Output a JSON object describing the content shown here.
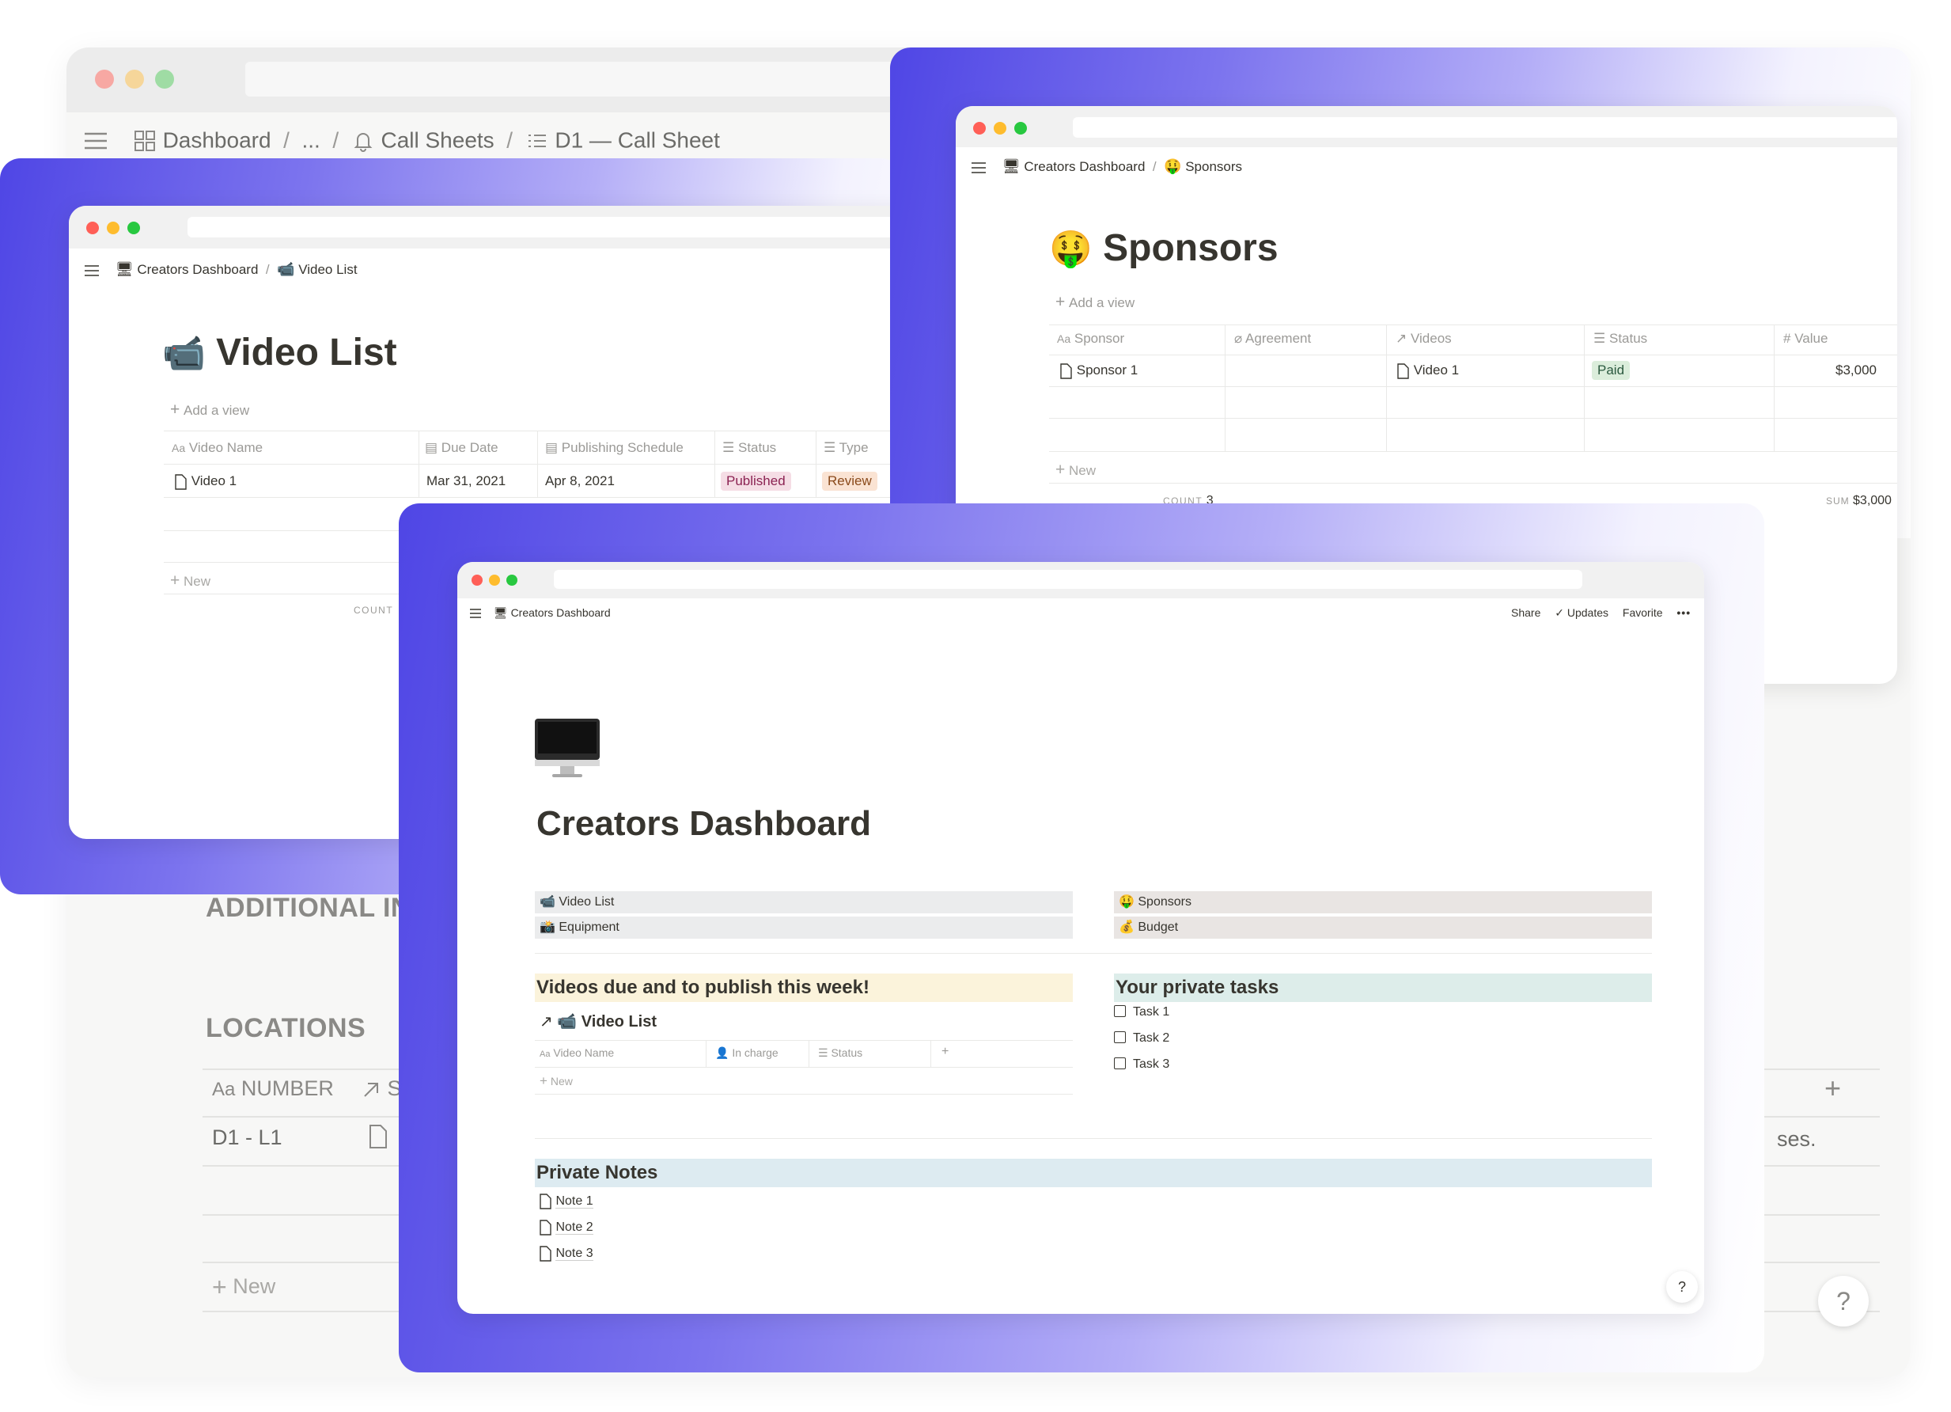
{
  "background_window": {
    "breadcrumb": [
      "Dashboard",
      "...",
      "Call Sheets",
      "D1 — Call Sheet"
    ],
    "section_additional": "ADDITIONAL INFO",
    "section_locations": "LOCATIONS",
    "table": {
      "headers": [
        "NUMBER",
        "S"
      ],
      "row_number": "D1 - L1",
      "row_tail_text": "ses.",
      "new_label": "New"
    },
    "help_label": "?"
  },
  "video_list_window": {
    "breadcrumb": [
      "Creators Dashboard",
      "Video List"
    ],
    "title": "Video List",
    "add_view": "Add a view",
    "columns": [
      "Video Name",
      "Due Date",
      "Publishing Schedule",
      "Status",
      "Type"
    ],
    "rows": [
      {
        "name": "Video 1",
        "due": "Mar 31, 2021",
        "publish": "Apr 8, 2021",
        "status": "Published",
        "type": "Review"
      }
    ],
    "new_label": "New",
    "count_label": "COUNT"
  },
  "sponsors_window": {
    "breadcrumb": [
      "Creators Dashboard",
      "Sponsors"
    ],
    "title": "Sponsors",
    "add_view": "Add a view",
    "columns": [
      "Sponsor",
      "Agreement",
      "Videos",
      "Status",
      "Value"
    ],
    "rows": [
      {
        "sponsor": "Sponsor 1",
        "agreement": "",
        "videos": "Video 1",
        "status": "Paid",
        "value": "$3,000"
      }
    ],
    "new_label": "New",
    "count_label": "COUNT",
    "count_value": "3",
    "sum_label": "SUM",
    "sum_value": "$3,000"
  },
  "dashboard_window": {
    "breadcrumb": "Creators Dashboard",
    "actions": {
      "share": "Share",
      "updates": "Updates",
      "favorite": "Favorite",
      "more": "•••"
    },
    "title": "Creators Dashboard",
    "links_left": [
      "Video List",
      "Equipment"
    ],
    "links_right": [
      "Sponsors",
      "Budget"
    ],
    "videos_due_heading": "Videos due and to publish this week!",
    "linked_db_title": "Video List",
    "linked_db_columns": [
      "Video Name",
      "In charge",
      "Status"
    ],
    "linked_db_new": "New",
    "tasks_heading": "Your private tasks",
    "tasks": [
      "Task 1",
      "Task 2",
      "Task 3"
    ],
    "notes_heading": "Private Notes",
    "notes": [
      "Note 1",
      "Note 2",
      "Note 3"
    ],
    "help_label": "?"
  },
  "colors": {
    "accent_gradient_start": "#4f46e5",
    "published_tag_bg": "#f5dde5",
    "published_tag_text": "#8b2252",
    "review_tag_bg": "#fae3d3",
    "review_tag_text": "#8a4a1b",
    "paid_tag_bg": "#dbeddb",
    "paid_tag_text": "#2b593f",
    "videos_due_bg": "#fbf3db",
    "tasks_bg": "#ddedea",
    "notes_bg": "#ddebf1",
    "links_left_bg": "#ebeced",
    "links_right_bg": "#e9e5e3"
  }
}
